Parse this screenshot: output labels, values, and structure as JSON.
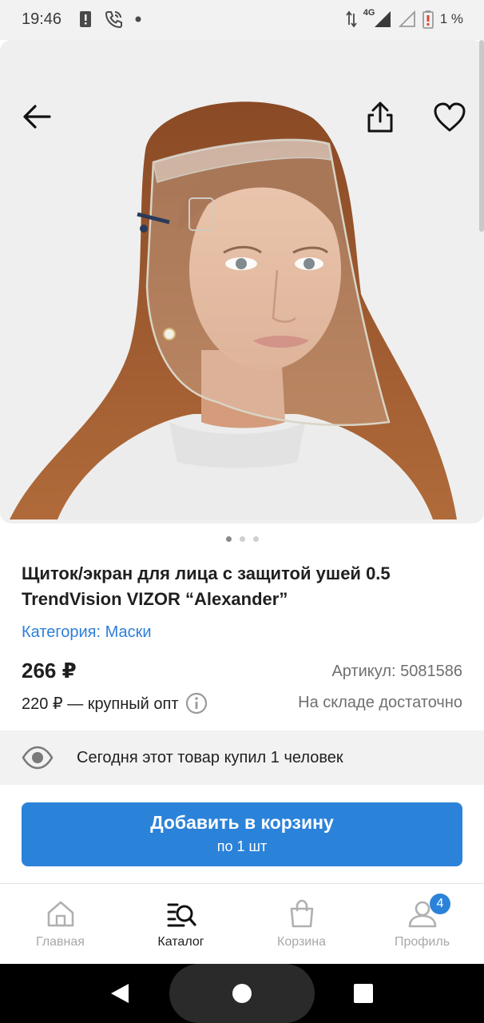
{
  "status_bar": {
    "time": "19:46",
    "network": "4G",
    "battery": "1 %",
    "icons": [
      "alert-icon",
      "wifi-call-icon",
      "dot-icon",
      "data-arrows-icon",
      "signal-icon",
      "battery-icon"
    ]
  },
  "gallery": {
    "image_alt": "product-photo",
    "slides": 3,
    "active_slide": 1
  },
  "header": {
    "back_icon": "arrow-left-icon",
    "share_icon": "share-icon",
    "favorite_icon": "heart-icon"
  },
  "product": {
    "title": "Щиток/экран для лица с защитой ушей 0.5 TrendVision VIZOR “Alexander”",
    "category": "Категория: Маски",
    "price": "266 ₽",
    "sku": "Артикул: 5081586",
    "wholesale": "220 ₽ — крупный опт",
    "stock": "На складе достаточно"
  },
  "viewers": {
    "text": "Сегодня этот товар купил 1 человек"
  },
  "cart_button": {
    "label": "Добавить в корзину",
    "sub": "по 1 шт"
  },
  "tab_bar": {
    "items": [
      {
        "label": "Главная",
        "icon": "home-icon"
      },
      {
        "label": "Каталог",
        "icon": "catalog-search-icon"
      },
      {
        "label": "Корзина",
        "icon": "bag-icon"
      },
      {
        "label": "Профиль",
        "icon": "profile-icon",
        "badge": "4"
      }
    ],
    "active": "Каталог"
  },
  "colors": {
    "accent": "#2b82d9",
    "link": "#2d7fd8",
    "muted": "#6f6f6f"
  }
}
